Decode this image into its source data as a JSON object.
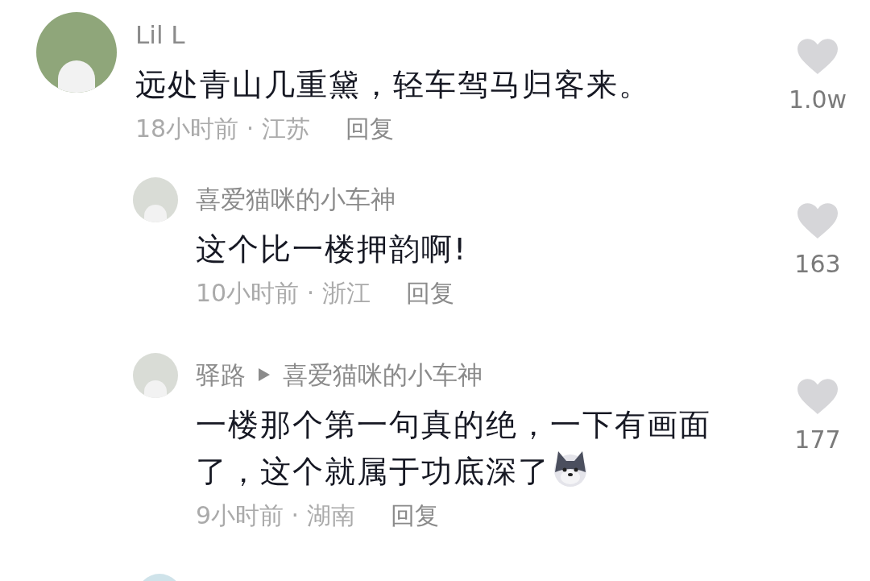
{
  "comments": [
    {
      "author": "Lil L",
      "text": "远处青山几重黛，轻车驾马归客来。",
      "has_sticker": false,
      "meta": "18小时前 · 江苏",
      "reply_label": "回复",
      "likes": "1.0w",
      "replies": [
        {
          "author": "喜爱猫咪的小车神",
          "text": "这个比一楼押韵啊!",
          "has_sticker": false,
          "meta": "10小时前 · 浙江",
          "reply_label": "回复",
          "likes": "163"
        },
        {
          "author": "驿路",
          "reply_to": "喜爱猫咪的小车神",
          "text": "一楼那个第一句真的绝，一下有画面了，这个就属于功底深了",
          "has_sticker": true,
          "meta": "9小时前 · 湖南",
          "reply_label": "回复",
          "likes": "177"
        }
      ]
    }
  ]
}
